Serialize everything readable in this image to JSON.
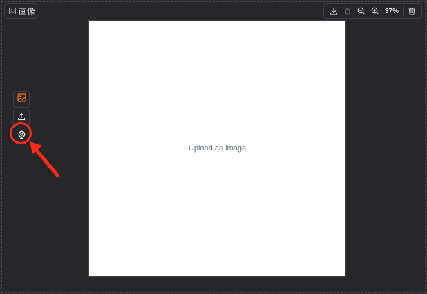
{
  "header": {
    "label": "画像"
  },
  "toolbar": {
    "zoom_level": "37%",
    "buttons": [
      "download-icon",
      "hand-icon",
      "zoom-out-icon",
      "zoom-in-icon",
      "trash-icon"
    ]
  },
  "canvas": {
    "placeholder": "Upload an image"
  },
  "sources": [
    {
      "icon": "image-icon",
      "active": true
    },
    {
      "icon": "upload-icon",
      "active": false
    },
    {
      "icon": "webcam-icon",
      "active": false
    }
  ],
  "colors": {
    "accent": "#f97316",
    "annotation": "#ff2a1a",
    "panel_bg": "#27272a"
  }
}
